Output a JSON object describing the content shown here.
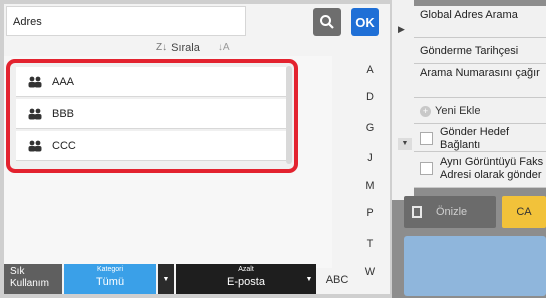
{
  "address": {
    "label": "Adres"
  },
  "toolbar": {
    "ok_label": "OK"
  },
  "sort": {
    "label": "Sırala",
    "icon_az": "Z↓",
    "icon_a": "↓A"
  },
  "list": {
    "items": [
      {
        "label": "AAA",
        "icon": "group-icon"
      },
      {
        "label": "BBB",
        "icon": "group-icon"
      },
      {
        "label": "CCC",
        "icon": "group-icon"
      }
    ]
  },
  "alphabet": [
    "A",
    "D",
    "G",
    "J",
    "M",
    "P",
    "T",
    "W"
  ],
  "bottom": {
    "sik": "Sık Kullanım",
    "kategori_label": "Kategori",
    "kategori_value": "Tümü",
    "azalt_label": "Azalt",
    "azalt_value": "E-posta",
    "abc": "ABC"
  },
  "right_panel": {
    "global_search": "Global Adres Arama",
    "send_history": "Gönderme Tarihçesi",
    "recall_number": "Arama Numarasını çağır",
    "add_new": "Yeni Ekle",
    "send_link": "Gönder Hedef Bağlantı",
    "same_image": "Aynı Görüntüyü Faks Adresi olarak gönder",
    "preview": "Önizle",
    "ca": "CA"
  },
  "colors": {
    "accent_blue": "#1f6fd6",
    "highlight_red": "#e3232f",
    "category_blue": "#3aa0e8",
    "ca_yellow": "#f2c23a"
  }
}
